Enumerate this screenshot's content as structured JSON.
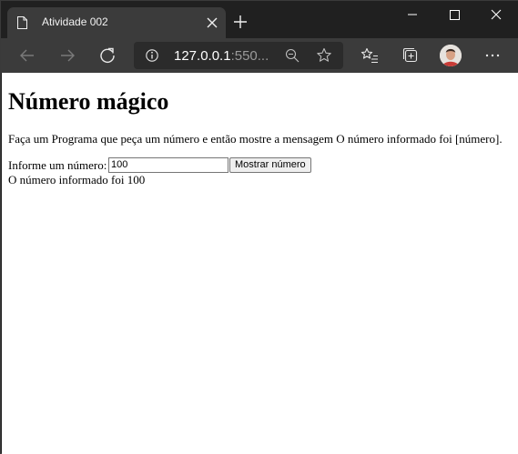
{
  "browser": {
    "tab_title": "Atividade 002",
    "url_host": "127.0.0.1",
    "url_rest": ":550..."
  },
  "page": {
    "heading": "Número mágico",
    "description": "Faça um Programa que peça um número e então mostre a mensagem O número informado foi [número].",
    "input_label": "Informe um número:",
    "input_value": "100",
    "button_label": "Mostrar número",
    "result": "O número informado foi 100"
  },
  "icons": {
    "page": "page-icon",
    "close_tab": "close-icon",
    "new_tab": "plus-icon",
    "back": "arrow-left-icon",
    "forward": "arrow-right-icon",
    "refresh": "refresh-icon",
    "info": "info-icon",
    "zoom": "zoom-out-icon",
    "favorite": "star-icon",
    "favorites": "favorites-icon",
    "collections": "collections-icon",
    "profile": "avatar",
    "menu": "more-icon"
  }
}
